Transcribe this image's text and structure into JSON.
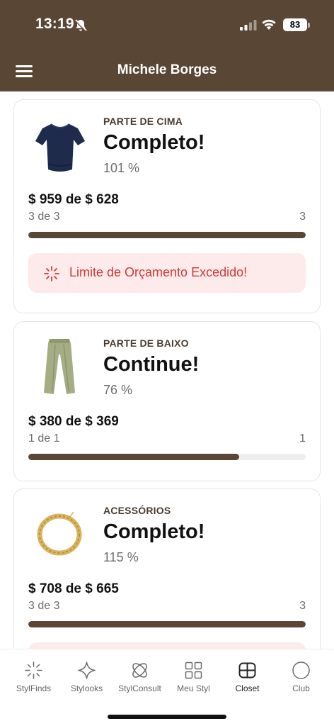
{
  "status_bar": {
    "time": "13:19",
    "battery": "83"
  },
  "header": {
    "title": "Michele Borges"
  },
  "cards": [
    {
      "category": "PARTE DE CIMA",
      "status": "Completo!",
      "percent": "101 %",
      "amount": "$ 959 de $ 628",
      "count_left": "3 de 3",
      "count_right": "3",
      "progress": 1.0,
      "alert": "Limite de Orçamento Excedido!",
      "image": "navy-tshirt"
    },
    {
      "category": "PARTE DE BAIXO",
      "status": "Continue!",
      "percent": "76 %",
      "amount": "$ 380 de $ 369",
      "count_left": "1 de 1",
      "count_right": "1",
      "progress": 0.76,
      "image": "green-trousers"
    },
    {
      "category": "ACESSÓRIOS",
      "status": "Completo!",
      "percent": "115 %",
      "amount": "$ 708 de $ 665",
      "count_left": "3 de 3",
      "count_right": "3",
      "progress": 1.0,
      "image": "gold-necklace"
    }
  ],
  "tabs": [
    {
      "label": "StylFinds",
      "icon": "sparkle-icon"
    },
    {
      "label": "Stylooks",
      "icon": "star-icon"
    },
    {
      "label": "StylConsult",
      "icon": "orbit-icon"
    },
    {
      "label": "Meu Styl",
      "icon": "grid-icon"
    },
    {
      "label": "Closet",
      "icon": "closet-icon",
      "active": true
    },
    {
      "label": "Club",
      "icon": "circle-icon"
    }
  ],
  "colors": {
    "brand": "#5a4634",
    "alert_bg": "#fcebea",
    "alert_text": "#cf3a3a"
  }
}
